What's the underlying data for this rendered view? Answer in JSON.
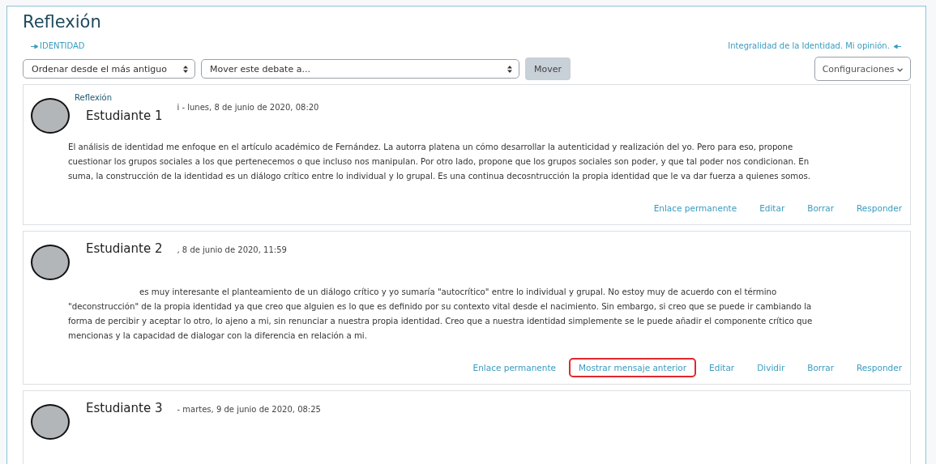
{
  "title": "Reflexión",
  "nav": {
    "previous": "IDENTIDAD",
    "next": "Integralidad de la Identidad. Mi opinión."
  },
  "controls": {
    "sort": "Ordenar desde el más antiguo",
    "move_select": "Mover este debate a...",
    "move_button": "Mover",
    "settings": "Configuraciones"
  },
  "posts": [
    {
      "subject": "Reflexión",
      "author": "Estudiante 1",
      "date": "i - lunes, 8 de junio de 2020, 08:20",
      "redacted_start": false,
      "lines": [
        "El análisis de identidad me enfoque en el artículo académico de Fernández. La autorra platena un cómo desarrollar la autenticidad y realización del yo. Pero para eso, propone",
        "cuestionar los grupos sociales a los que pertenecemos o que incluso nos manipulan. Por otro lado, propone que los grupos sociales son poder, y que tal poder nos condicionan. En",
        "suma, la construcción de la identidad es un diálogo crítico entre lo individual y lo grupal. Es una continua decosntrucción la propia identidad que le va dar fuerza a quienes somos."
      ],
      "actions": [
        {
          "label": "Enlace permanente",
          "highlighted": false
        },
        {
          "label": "Editar",
          "highlighted": false
        },
        {
          "label": "Borrar",
          "highlighted": false
        },
        {
          "label": "Responder",
          "highlighted": false
        }
      ]
    },
    {
      "author": "Estudiante 2",
      "date": ", 8 de junio de 2020, 11:59",
      "redacted_start": true,
      "lines": [
        "es muy interesante el planteamiento de un diálogo crítico y yo sumaría \"autocrítico\" entre lo individual y grupal. No estoy muy de acuerdo con el término",
        "\"deconstrucción\" de la propia identidad ya que creo que alguien es lo que es definido por su contexto vital desde el nacimiento. Sin embargo, si creo que se puede ir cambiando la",
        "forma de percibir y aceptar lo otro, lo ajeno a mi, sin renunciar a nuestra propia identidad. Creo que a nuestra identidad simplemente se le puede añadir el componente crítico que",
        "mencionas y la capacidad de dialogar con la diferencia en relación a mi."
      ],
      "actions": [
        {
          "label": "Enlace permanente",
          "highlighted": false
        },
        {
          "label": "Mostrar mensaje anterior",
          "highlighted": true
        },
        {
          "label": "Editar",
          "highlighted": false
        },
        {
          "label": "Dividir",
          "highlighted": false
        },
        {
          "label": "Borrar",
          "highlighted": false
        },
        {
          "label": "Responder",
          "highlighted": false
        }
      ]
    },
    {
      "author": "Estudiante 3",
      "date": "- martes, 9 de junio de 2020, 08:25"
    }
  ]
}
